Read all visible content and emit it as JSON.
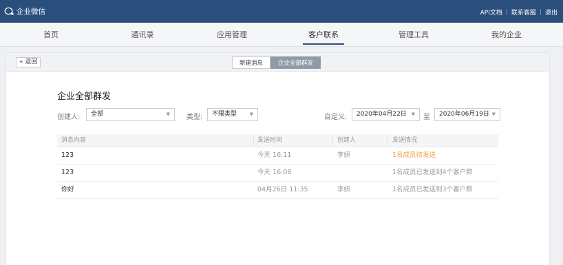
{
  "app": {
    "title": "企业微信"
  },
  "top_links": [
    "API文档",
    "联系客服",
    "退出"
  ],
  "nav": {
    "items": [
      "首页",
      "通讯录",
      "应用管理",
      "客户联系",
      "管理工具",
      "我的企业"
    ],
    "active_index": 3
  },
  "panel": {
    "back_label": "« 返回",
    "tabs": [
      "新建消息",
      "企业全部群发"
    ],
    "active_tab": 1
  },
  "page_title": "企业全部群发",
  "filters": {
    "creator_label": "创建人:",
    "creator_value": "全部",
    "type_label": "类型:",
    "type_value": "不限类型",
    "custom_label": "自定义:",
    "date_from": "2020年04月22日",
    "to_label": "至",
    "date_to": "2020年06月19日"
  },
  "table": {
    "headers": [
      "消息内容",
      "发送时间",
      "创建人",
      "发送情况"
    ],
    "rows": [
      {
        "content": "123",
        "time": "今天 16:11",
        "creator": "李妍",
        "status": "1名成员待发送",
        "status_color": "#f0a04b"
      },
      {
        "content": "123",
        "time": "今天 16:08",
        "creator": "",
        "status": "1名成员已发送到4个客户群",
        "status_color": "#666666"
      },
      {
        "content": "你好",
        "time": "04月26日 11:35",
        "creator": "李妍",
        "status": "1名成员已发送到3个客户群",
        "status_color": "#666666"
      }
    ]
  },
  "colors": {
    "brand": "#2b4f7c",
    "warning": "#f0a04b"
  }
}
